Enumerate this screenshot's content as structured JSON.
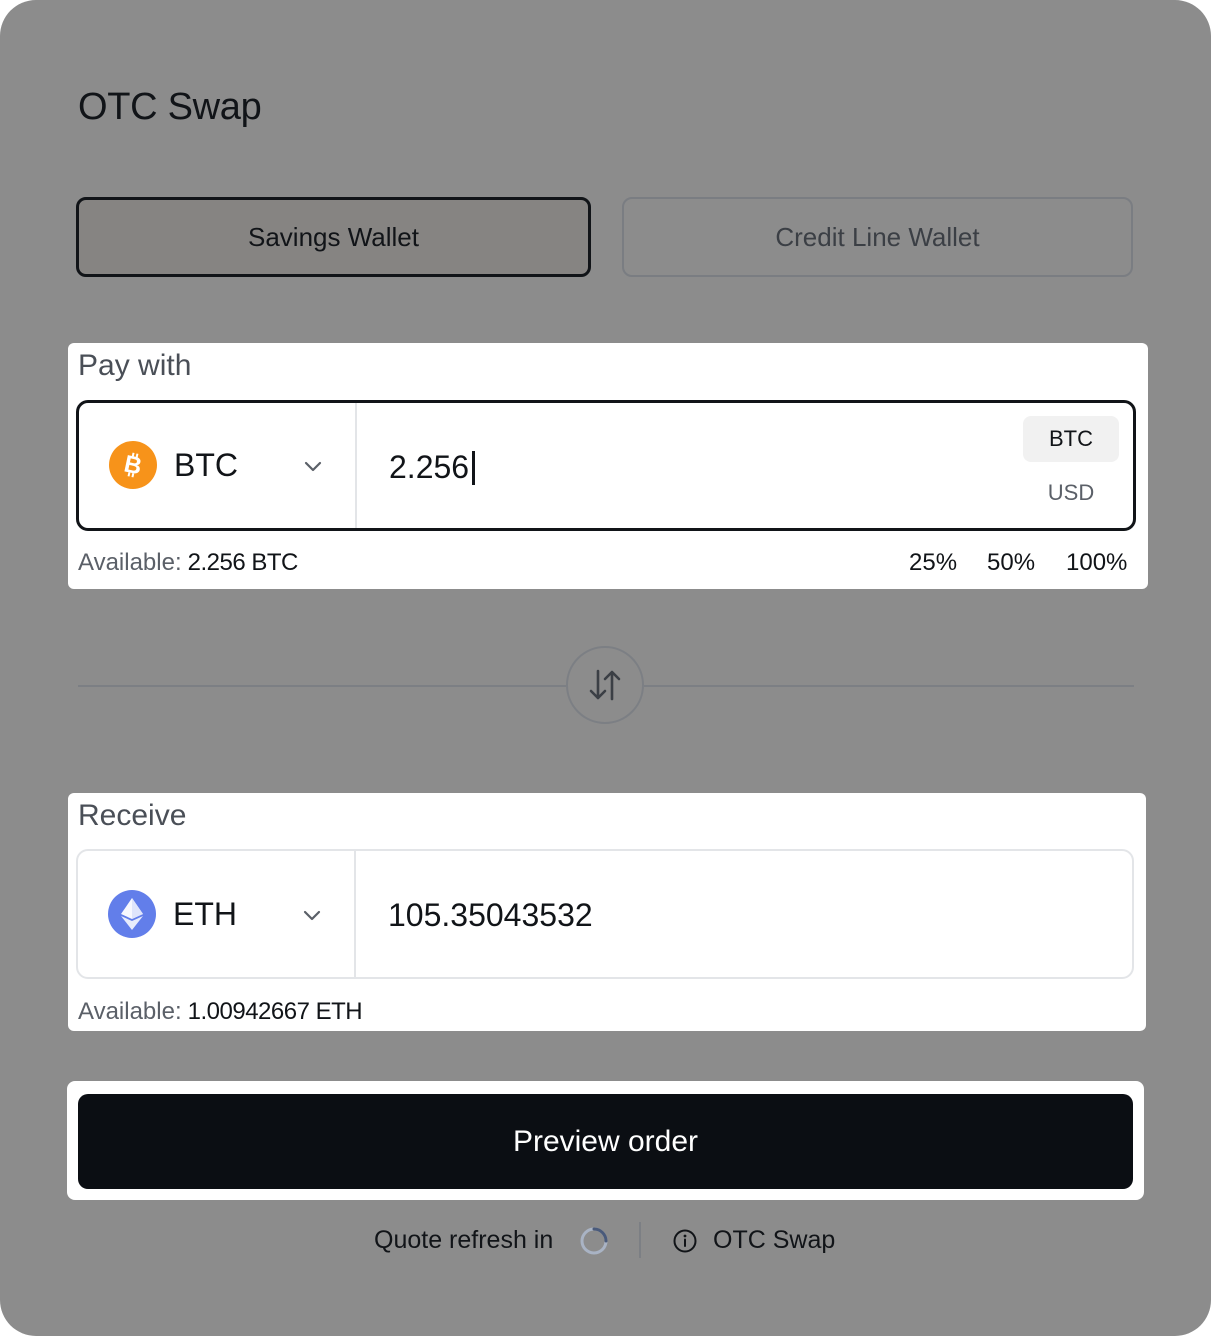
{
  "title": "OTC Swap",
  "wallet_tabs": [
    {
      "label": "Savings Wallet",
      "active": true
    },
    {
      "label": "Credit Line Wallet",
      "active": false
    }
  ],
  "pay": {
    "label": "Pay with",
    "asset": "BTC",
    "amount": "2.256",
    "unit_options": [
      "BTC",
      "USD"
    ],
    "selected_unit": "BTC",
    "available_label": "Available:",
    "available_value": "2.256 BTC",
    "percent_options": [
      "25%",
      "50%",
      "100%"
    ]
  },
  "receive": {
    "label": "Receive",
    "asset": "ETH",
    "amount": "105.35043532",
    "available_label": "Available:",
    "available_value": "1.00942667 ETH"
  },
  "preview_button": "Preview order",
  "footer": {
    "quote_refresh_label": "Quote refresh in",
    "otc_label": "OTC Swap"
  },
  "colors": {
    "background_overlay": "#8c8c8c",
    "btc": "#f7931a",
    "eth": "#627eea",
    "primary_button": "#0b0e13"
  },
  "icons": {
    "btc": "bitcoin-icon",
    "eth": "ethereum-icon",
    "chevron": "chevron-down-icon",
    "swap": "swap-arrows-icon",
    "spinner": "loading-spinner-icon",
    "info": "info-icon"
  }
}
